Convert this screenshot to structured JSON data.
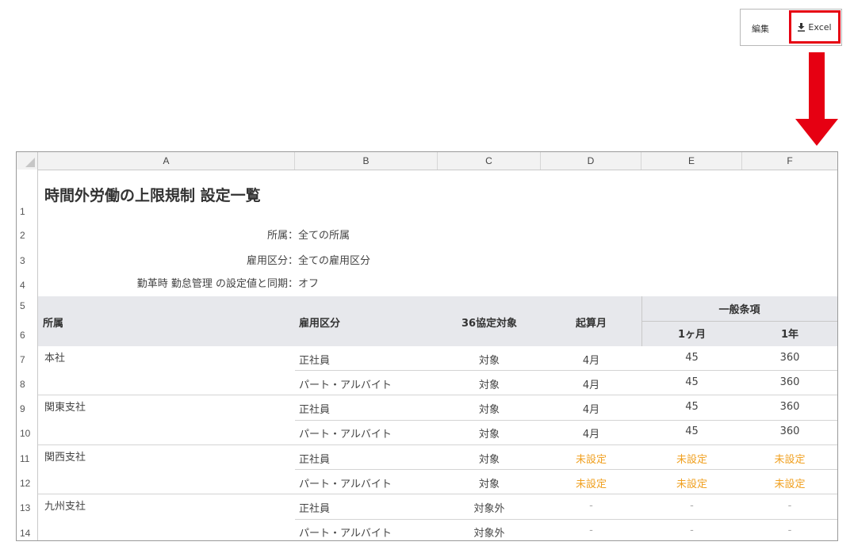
{
  "toolbar": {
    "edit_label": "編集",
    "excel_label": "Excel",
    "excel_icon": "download-icon",
    "highlight_color": "#e60012"
  },
  "annotation": {
    "arrow_color": "#e60012"
  },
  "sheet": {
    "columns": [
      "A",
      "B",
      "C",
      "D",
      "E",
      "F"
    ],
    "rows": [
      "1",
      "2",
      "3",
      "4",
      "5",
      "6",
      "7",
      "8",
      "9",
      "10",
      "11",
      "12",
      "13",
      "14"
    ],
    "title": "時間外労働の上限規制 設定一覧",
    "meta": [
      {
        "label": "所属：",
        "value": "全ての所属"
      },
      {
        "label": "雇用区分：",
        "value": "全ての雇用区分"
      },
      {
        "label": "勤革時 勤怠管理 の設定値と同期：",
        "value": "オフ"
      }
    ],
    "headers": {
      "dept": "所属",
      "employment": "雇用区分",
      "target36": "36協定対象",
      "start_month": "起算月",
      "general": "一般条項",
      "one_month": "1ヶ月",
      "one_year": "1年"
    },
    "data_rows": [
      {
        "dept": "本社",
        "type": "正社員",
        "target": "対象",
        "start": "4月",
        "month": "45",
        "year": "360"
      },
      {
        "dept": "",
        "type": "パート・アルバイト",
        "target": "対象",
        "start": "4月",
        "month": "45",
        "year": "360"
      },
      {
        "dept": "関東支社",
        "type": "正社員",
        "target": "対象",
        "start": "4月",
        "month": "45",
        "year": "360"
      },
      {
        "dept": "",
        "type": "パート・アルバイト",
        "target": "対象",
        "start": "4月",
        "month": "45",
        "year": "360"
      },
      {
        "dept": "関西支社",
        "type": "正社員",
        "target": "対象",
        "start": "未設定",
        "month": "未設定",
        "year": "未設定"
      },
      {
        "dept": "",
        "type": "パート・アルバイト",
        "target": "対象",
        "start": "未設定",
        "month": "未設定",
        "year": "未設定"
      },
      {
        "dept": "九州支社",
        "type": "正社員",
        "target": "対象外",
        "start": "-",
        "month": "-",
        "year": "-"
      },
      {
        "dept": "",
        "type": "パート・アルバイト",
        "target": "対象外",
        "start": "-",
        "month": "-",
        "year": "-"
      }
    ],
    "unset_color": "#f0a020"
  }
}
